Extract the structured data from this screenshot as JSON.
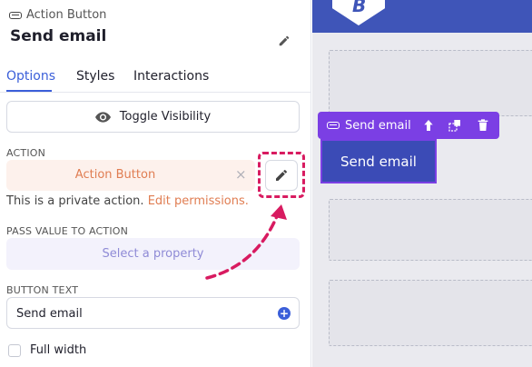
{
  "header": {
    "component_type": "Action Button",
    "title": "Send email"
  },
  "tabs": [
    {
      "label": "Options",
      "active": true
    },
    {
      "label": "Styles",
      "active": false
    },
    {
      "label": "Interactions",
      "active": false
    }
  ],
  "toggle_visibility": {
    "label": "Toggle Visibility"
  },
  "action": {
    "section_label": "ACTION",
    "value": "Action Button",
    "clear_symbol": "×",
    "private_note": "This is a private action.",
    "permissions_link": "Edit permissions."
  },
  "pass_value": {
    "section_label": "PASS VALUE TO ACTION",
    "placeholder": "Select a property"
  },
  "button_text": {
    "section_label": "BUTTON TEXT",
    "value": "Send email",
    "add_symbol": "+"
  },
  "full_width": {
    "label": "Full width",
    "checked": false
  },
  "canvas": {
    "logo_letter": "B",
    "toolbar_label": "Send email",
    "button_label": "Send email"
  },
  "colors": {
    "accent": "#3b5fd9",
    "highlight": "#d81b60",
    "orange": "#e07d52",
    "toolbar_purple": "#7b3fe4",
    "canvas_blue": "#3f55b8"
  },
  "icons": [
    "button-icon",
    "pencil-icon",
    "eye-icon",
    "close-icon",
    "plus-icon",
    "arrow-up-icon",
    "resize-icon",
    "trash-icon"
  ]
}
